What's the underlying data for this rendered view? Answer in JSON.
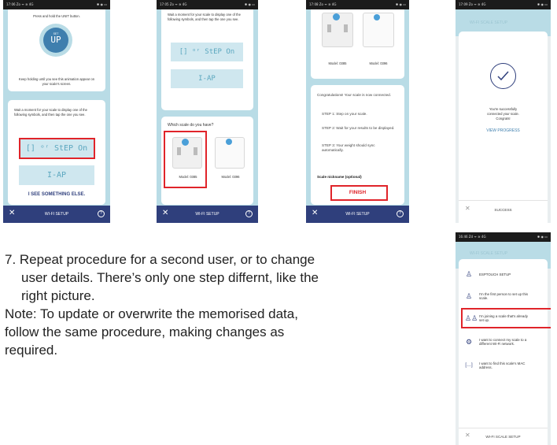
{
  "screen1": {
    "status_time": "17:06 Zo ᯤ ≋ 4G",
    "status_icons": "✱ ◉ ▭",
    "press_text": "Press and hold the UNIT button.",
    "unit_badge_small": "SET",
    "unit_badge_big": "UP",
    "keep_holding": "Keep holding until you see this animation appear on your scale's screen.",
    "wait_text": "Wait a moment for your scale to display one of the following symbols, and then tap the one you see.",
    "symbol1": "[] ᵒʳ StEP On",
    "symbol2": "I-AP",
    "see_else": "I SEE SOMETHING ELSE.",
    "close_label": "✕",
    "footer_title": "WI-FI SETUP",
    "help_label": "?"
  },
  "screen2": {
    "status_time": "17:05 Zo ᯤ ≋ 4G",
    "status_icons": "✱ ◉ ▭",
    "wait_text": "Wait a moment for your scale to display one of the following symbols, and then tap the one you see.",
    "symbol1": "[] ᵒʳ StEP On",
    "symbol2": "I-AP",
    "question": "Which scale do you have?",
    "model_a": "Model: 0385",
    "model_b": "Model: 0396",
    "close_label": "✕",
    "footer_title": "WI-FI SETUP",
    "help_label": "?"
  },
  "screen3": {
    "status_time": "17:08 Zo ᯤ ≋ 4G",
    "status_icons": "✱ ◉ ▭",
    "model_a": "Model: 0385",
    "model_b": "Model: 0396",
    "congrats": "Congratulations! Your scale is now connected.",
    "step1": "STEP 1: Step on your scale.",
    "step2": "STEP 2: Wait for your results to be displayed.",
    "step3": "STEP 3: Your weight should sync automatically.",
    "nickname": "Scale nickname (optional)",
    "finish": "FINISH",
    "close_label": "✕",
    "footer_title": "WI-FI SETUP",
    "help_label": "?"
  },
  "screen4": {
    "status_time": "17:09 Zo ᯤ ≋ 4G",
    "status_icons": "✱ ◉ ▭",
    "header_faded": "WI-FI SCALE SETUP",
    "success_msg": "You're successfully connected your scale. Congrats!",
    "view_progress": "VIEW PROGRESS",
    "close_label": "✕",
    "footer_title": "SUCCESS"
  },
  "screen5": {
    "status_time": "16:46 Zd ᯤ ≋ 4G",
    "status_icons": "✱ ◉ ▭",
    "header_faded": "WI-FI SCALE SETUP",
    "items": [
      {
        "icon": "person-icon",
        "label": "ESPTOUCH SETUP"
      },
      {
        "icon": "person-icon",
        "label": "I'm the first person to set up this scale."
      },
      {
        "icon": "people-icon",
        "label": "I'm joining a scale that's already set up."
      },
      {
        "icon": "gear-icon",
        "label": "I want to connect my scale to a different Wi-Fi network."
      },
      {
        "icon": "mac-icon",
        "label": "I want to find this scale's MAC address."
      }
    ],
    "close_label": "✕",
    "footer_title": "WI-FI SCALE SETUP"
  },
  "instructions": {
    "step7_line1": "7. Repeat procedure for a second user, or to change",
    "step7_line2": "user details. There’s only one step differnt, like the",
    "step7_line3": "right picture.",
    "note_line1": "Note: To update or overwrite the memorised data,",
    "note_line2": "follow the same procedure, making changes as",
    "note_line3": "required."
  },
  "colors": {
    "accent_red": "#e0242a",
    "nav_blue": "#2f3f7c",
    "sky_bg": "#b9dce6",
    "lcd_text": "#5ba7bf"
  }
}
